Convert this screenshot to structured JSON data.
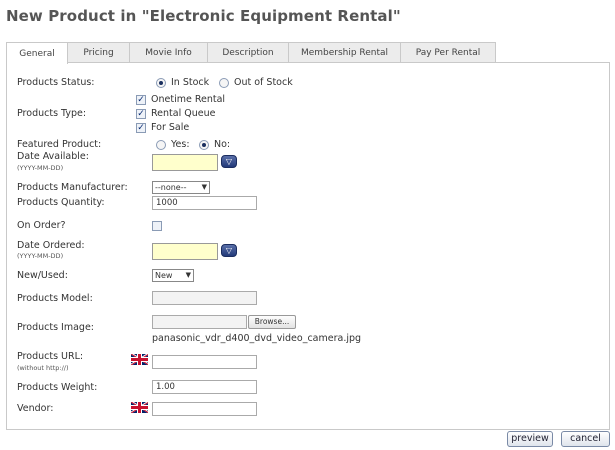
{
  "page": {
    "title": "New Product in \"Electronic Equipment Rental\""
  },
  "tabs": [
    {
      "label": "General",
      "active": true
    },
    {
      "label": "Pricing"
    },
    {
      "label": "Movie Info"
    },
    {
      "label": "Description"
    },
    {
      "label": "Membership Rental"
    },
    {
      "label": "Pay Per Rental"
    }
  ],
  "form": {
    "status": {
      "label": "Products Status:",
      "in_stock": "In Stock",
      "out_of_stock": "Out of Stock",
      "selected": "In Stock"
    },
    "type": {
      "label": "Products Type:",
      "onetime": "Onetime Rental",
      "queue": "Rental Queue",
      "sale": "For Sale",
      "checked": [
        "Onetime Rental",
        "Rental Queue",
        "For Sale"
      ]
    },
    "featured": {
      "label": "Featured Product:",
      "yes": "Yes:",
      "no": "No:",
      "selected": "No"
    },
    "date_available": {
      "label": "Date Available:",
      "hint": "(YYYY-MM-DD)",
      "value": ""
    },
    "manufacturer": {
      "label": "Products Manufacturer:",
      "value": "--none--"
    },
    "quantity": {
      "label": "Products Quantity:",
      "value": "1000"
    },
    "on_order": {
      "label": "On Order?",
      "checked": false
    },
    "date_ordered": {
      "label": "Date Ordered:",
      "hint": "(YYYY-MM-DD)",
      "value": ""
    },
    "new_used": {
      "label": "New/Used:",
      "value": "New"
    },
    "model": {
      "label": "Products Model:",
      "value": ""
    },
    "image": {
      "label": "Products Image:",
      "browse": "Browse...",
      "filename": "panasonic_vdr_d400_dvd_video_camera.jpg"
    },
    "url": {
      "label": "Products URL:",
      "hint": "(without http://)",
      "value": ""
    },
    "weight": {
      "label": "Products Weight:",
      "value": "1.00"
    },
    "vendor": {
      "label": "Vendor:",
      "value": ""
    }
  },
  "footer": {
    "preview": "preview",
    "cancel": "cancel"
  },
  "icons": {
    "calendar": "calendar-dropdown-icon",
    "flag": "uk-flag-icon"
  }
}
